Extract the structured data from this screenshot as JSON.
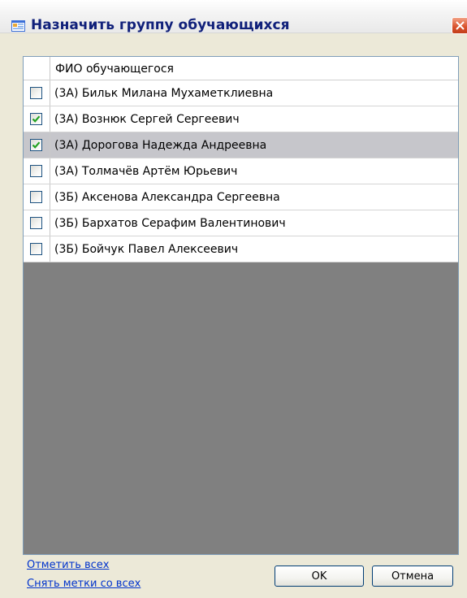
{
  "window": {
    "title": "Назначить группу обучающихся",
    "close_icon": "close-icon",
    "app_icon": "form-icon"
  },
  "grid": {
    "column_header": "ФИО обучающегося",
    "rows": [
      {
        "name": "(3А) Бильк Милана Мухаметклиевна",
        "checked": false,
        "selected": false
      },
      {
        "name": "(3А) Вознюк Сергей Сергеевич",
        "checked": true,
        "selected": false
      },
      {
        "name": "(3А) Дорогова Надежда Андреевна",
        "checked": true,
        "selected": true
      },
      {
        "name": "(3А) Толмачёв Артём Юрьевич",
        "checked": false,
        "selected": false
      },
      {
        "name": "(3Б) Аксенова Александра Сергеевна",
        "checked": false,
        "selected": false
      },
      {
        "name": "(3Б) Бархатов Серафим Валентинович",
        "checked": false,
        "selected": false
      },
      {
        "name": "(3Б) Бойчук Павел Алексеевич",
        "checked": false,
        "selected": false
      }
    ]
  },
  "footer": {
    "check_all": "Отметить всех",
    "uncheck_all": "Снять метки со всех",
    "ok": "OK",
    "cancel": "Отмена"
  },
  "colors": {
    "title_text": "#10207a",
    "link": "#0033cc",
    "grid_empty": "#808080",
    "selected_row": "#c6c6cb",
    "check_mark": "#21a121"
  }
}
